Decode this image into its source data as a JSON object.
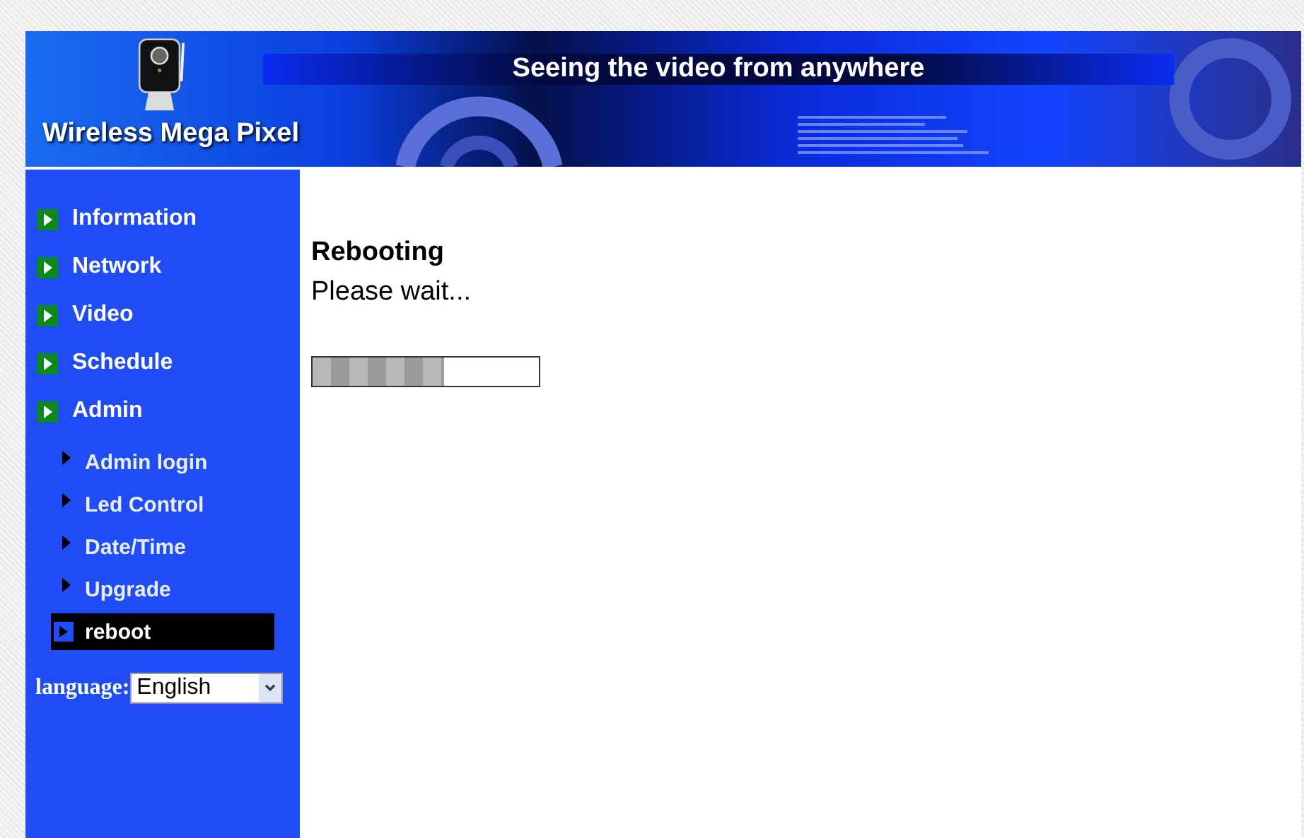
{
  "banner": {
    "brand": "Wireless Mega Pixel",
    "slogan": "Seeing the video from anywhere"
  },
  "sidebar": {
    "items": [
      {
        "label": "Information",
        "selected": false
      },
      {
        "label": "Network",
        "selected": false
      },
      {
        "label": "Video",
        "selected": false
      },
      {
        "label": "Schedule",
        "selected": false
      },
      {
        "label": "Admin",
        "selected": false,
        "children": [
          {
            "label": "Admin login",
            "selected": false
          },
          {
            "label": "Led Control",
            "selected": false
          },
          {
            "label": "Date/Time",
            "selected": false
          },
          {
            "label": "Upgrade",
            "selected": false
          },
          {
            "label": "reboot",
            "selected": true
          }
        ]
      }
    ],
    "language": {
      "label": "language:",
      "value": "English"
    }
  },
  "content": {
    "title": "Rebooting",
    "message": "Please wait...",
    "progress": {
      "level": 0.58
    }
  }
}
